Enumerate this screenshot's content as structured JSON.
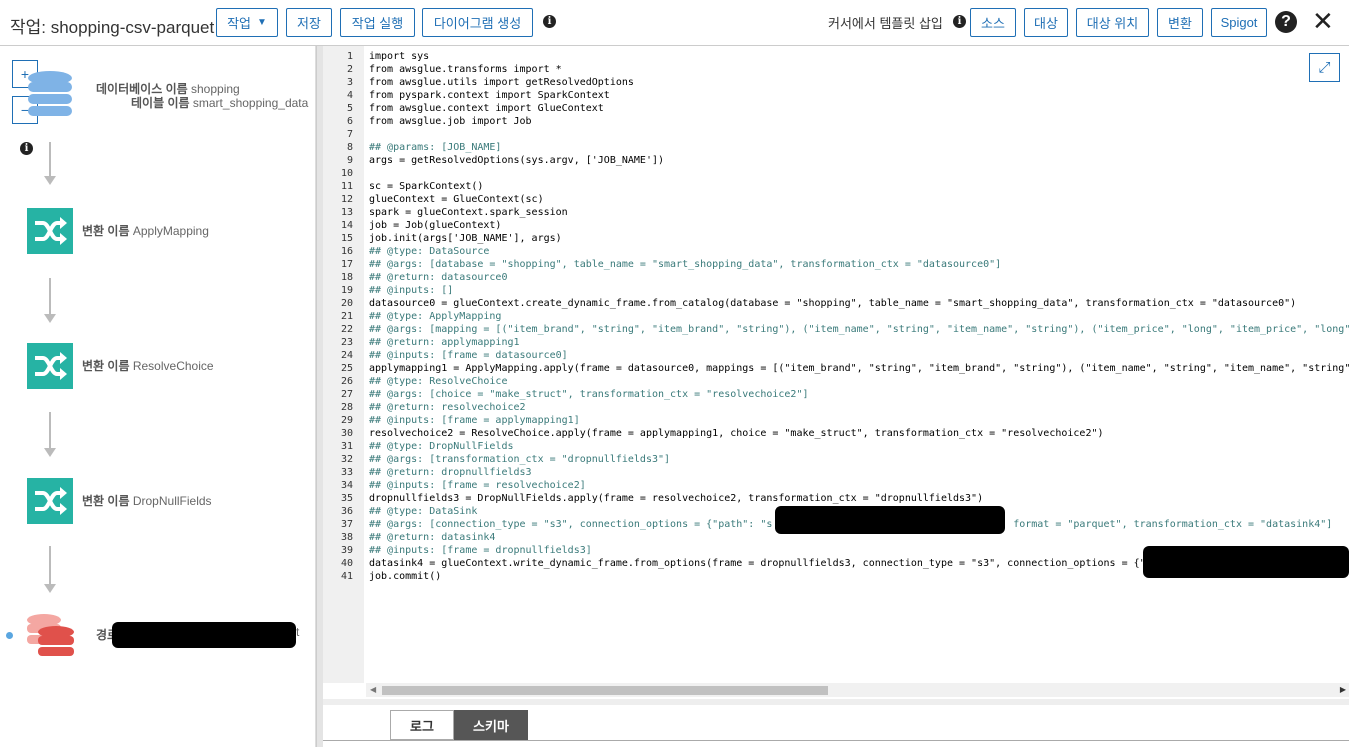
{
  "header": {
    "title": "작업: shopping-csv-parquet",
    "job_menu": "작업",
    "save": "저장",
    "run_job": "작업 실행",
    "generate_diagram": "다이어그램 생성",
    "insert_template_label": "커서에서 템플릿 삽입",
    "source": "소스",
    "target": "대상",
    "target_location": "대상 위치",
    "transform": "변환",
    "spigot": "Spigot"
  },
  "diagram": {
    "zoom_in": "+",
    "zoom_out": "−",
    "source_node": {
      "db_key": "데이터베이스 이름",
      "db_value": "shopping",
      "table_key": "테이블 이름",
      "table_value": "smart_shopping_data"
    },
    "transforms": [
      {
        "key": "변환 이름",
        "value": "ApplyMapping"
      },
      {
        "key": "변환 이름",
        "value": "ResolveChoice"
      },
      {
        "key": "변환 이름",
        "value": "DropNullFields"
      }
    ],
    "sink_node": {
      "key": "경로",
      "tail": "t"
    }
  },
  "code_lines": [
    "import sys",
    "from awsglue.transforms import *",
    "from awsglue.utils import getResolvedOptions",
    "from pyspark.context import SparkContext",
    "from awsglue.context import GlueContext",
    "from awsglue.job import Job",
    "",
    "## @params: [JOB_NAME]",
    "args = getResolvedOptions(sys.argv, ['JOB_NAME'])",
    "",
    "sc = SparkContext()",
    "glueContext = GlueContext(sc)",
    "spark = glueContext.spark_session",
    "job = Job(glueContext)",
    "job.init(args['JOB_NAME'], args)",
    "## @type: DataSource",
    "## @args: [database = \"shopping\", table_name = \"smart_shopping_data\", transformation_ctx = \"datasource0\"]",
    "## @return: datasource0",
    "## @inputs: []",
    "datasource0 = glueContext.create_dynamic_frame.from_catalog(database = \"shopping\", table_name = \"smart_shopping_data\", transformation_ctx = \"datasource0\")",
    "## @type: ApplyMapping",
    "## @args: [mapping = [(\"item_brand\", \"string\", \"item_brand\", \"string\"), (\"item_name\", \"string\", \"item_name\", \"string\"), (\"item_price\", \"long\", \"item_price\", \"long\"),",
    "## @return: applymapping1",
    "## @inputs: [frame = datasource0]",
    "applymapping1 = ApplyMapping.apply(frame = datasource0, mappings = [(\"item_brand\", \"string\", \"item_brand\", \"string\"), (\"item_name\", \"string\", \"item_name\", \"string\"),",
    "## @type: ResolveChoice",
    "## @args: [choice = \"make_struct\", transformation_ctx = \"resolvechoice2\"]",
    "## @return: resolvechoice2",
    "## @inputs: [frame = applymapping1]",
    "resolvechoice2 = ResolveChoice.apply(frame = applymapping1, choice = \"make_struct\", transformation_ctx = \"resolvechoice2\")",
    "## @type: DropNullFields",
    "## @args: [transformation_ctx = \"dropnullfields3\"]",
    "## @return: dropnullfields3",
    "## @inputs: [frame = resolvechoice2]",
    "dropnullfields3 = DropNullFields.apply(frame = resolvechoice2, transformation_ctx = \"dropnullfields3\")",
    "## @type: DataSink",
    "## @args: [connection_type = \"s3\", connection_options = {\"path\": \"s                                      , format = \"parquet\", transformation_ctx = \"datasink4\"]",
    "## @return: datasink4",
    "## @inputs: [frame = dropnullfields3]",
    "datasink4 = glueContext.write_dynamic_frame.from_options(frame = dropnullfields3, connection_type = \"s3\", connection_options = {\"p",
    "job.commit()"
  ],
  "bottom_tabs": {
    "log": "로그",
    "schema": "스키마"
  },
  "colors": {
    "accent": "#1f6fb5",
    "transform_node": "#26b3a4",
    "db_node": "#7fb3e6",
    "sink_node": "#e0514b"
  },
  "icons": [
    "chevron-down-icon",
    "info-icon",
    "help-icon",
    "close-icon",
    "database-icon",
    "shuffle-icon",
    "s3-bucket-icon",
    "expand-icon"
  ]
}
